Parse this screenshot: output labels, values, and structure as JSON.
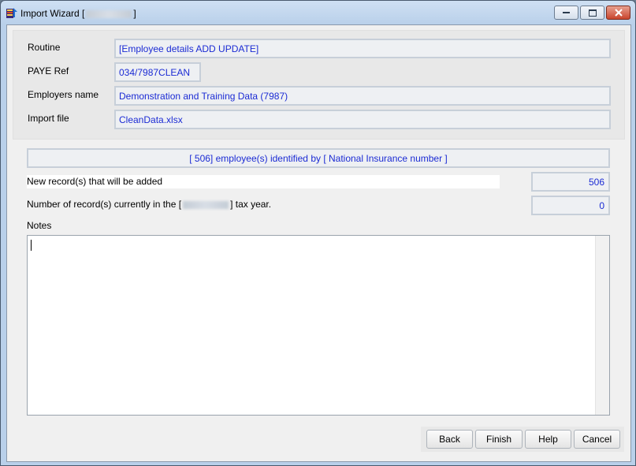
{
  "window": {
    "title_prefix": "Import Wizard [",
    "title_suffix": "]"
  },
  "form": {
    "routine_label": "Routine",
    "routine_value": "[Employee details ADD UPDATE]",
    "paye_label": "PAYE Ref",
    "paye_value": "034/7987CLEAN",
    "employer_label": "Employers name",
    "employer_value": "Demonstration and Training Data (7987)",
    "importfile_label": "Import file",
    "importfile_value": "CleanData.xlsx"
  },
  "summary": {
    "identified_text": "[       506] employee(s) identified by [ National Insurance number ]",
    "new_records_label": "New record(s) that will be added",
    "new_records_value": "506",
    "current_records_prefix": "Number of record(s) currently in the [",
    "current_records_suffix": "] tax year.",
    "current_records_value": "0",
    "notes_label": "Notes"
  },
  "buttons": {
    "back": "Back",
    "finish": "Finish",
    "help": "Help",
    "cancel": "Cancel"
  }
}
